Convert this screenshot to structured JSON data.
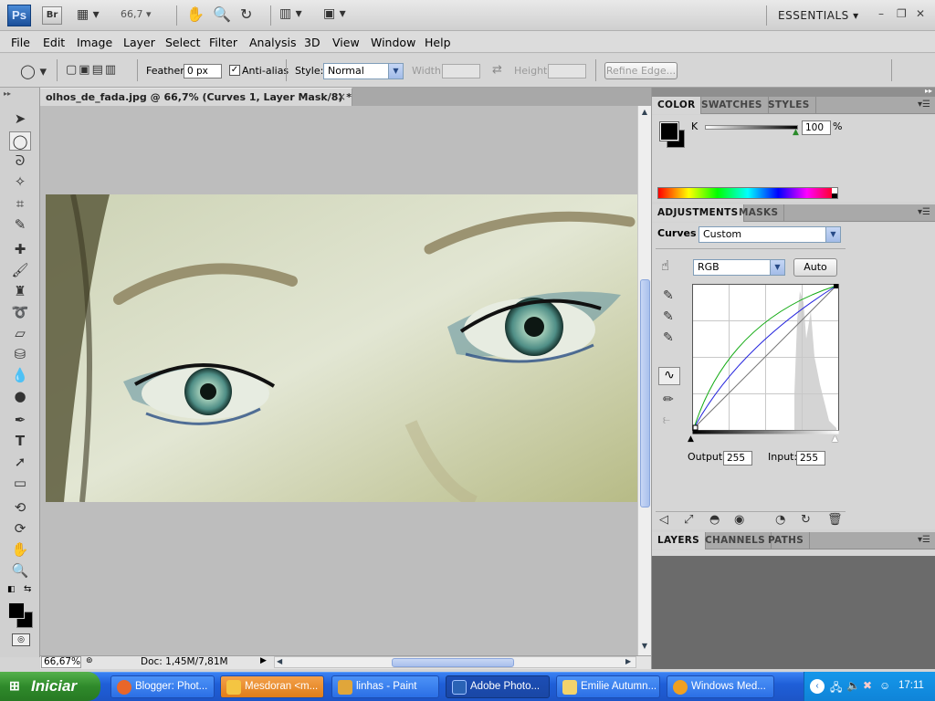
{
  "appbar": {
    "logo": "Ps",
    "bridge": "Br",
    "zoom": "66,7",
    "workspace": "ESSENTIALS",
    "window_minimize": "–",
    "window_restore": "❐",
    "window_close": "✕"
  },
  "menu": [
    "File",
    "Edit",
    "Image",
    "Layer",
    "Select",
    "Filter",
    "Analysis",
    "3D",
    "View",
    "Window",
    "Help"
  ],
  "options": {
    "feather_label": "Feather:",
    "feather_value": "0 px",
    "antialias_label": "Anti-alias",
    "style_label": "Style:",
    "style_value": "Normal",
    "width_label": "Width:",
    "height_label": "Height:",
    "refine_edge": "Refine Edge..."
  },
  "document": {
    "tab_title": "olhos_de_fada.jpg @ 66,7% (Curves 1, Layer Mask/8) *",
    "close": "×"
  },
  "status": {
    "zoom": "66,67%",
    "doc": "Doc: 1,45M/7,81M"
  },
  "color_panel": {
    "tabs": [
      "COLOR",
      "SWATCHES",
      "STYLES"
    ],
    "channel": "K",
    "value": "100",
    "unit": "%"
  },
  "adjustments_panel": {
    "tabs": [
      "ADJUSTMENTS",
      "MASKS"
    ],
    "type_label": "Curves",
    "preset": "Custom",
    "channel": "RGB",
    "auto": "Auto",
    "output_label": "Output:",
    "output_value": "255",
    "input_label": "Input:",
    "input_value": "255"
  },
  "layers_panel": {
    "tabs": [
      "LAYERS",
      "CHANNELS",
      "PATHS"
    ]
  },
  "taskbar": {
    "start": "Iniciar",
    "tasks": [
      {
        "label": "Blogger: Phot...",
        "color": "#e8662a"
      },
      {
        "label": "Mesdoran <m...",
        "color": "#f4c542"
      },
      {
        "label": "linhas - Paint",
        "color": "#e0a63a"
      },
      {
        "label": "Adobe Photo...",
        "color": "#2a63b5"
      },
      {
        "label": "Emilie Autumn...",
        "color": "#f2d36b"
      },
      {
        "label": "Windows Med...",
        "color": "#f0a020"
      }
    ],
    "clock": "17:11"
  },
  "colors": {
    "accent_blue": "#316ac5",
    "curve_green": "#11aa11",
    "curve_blue": "#2222dd"
  }
}
